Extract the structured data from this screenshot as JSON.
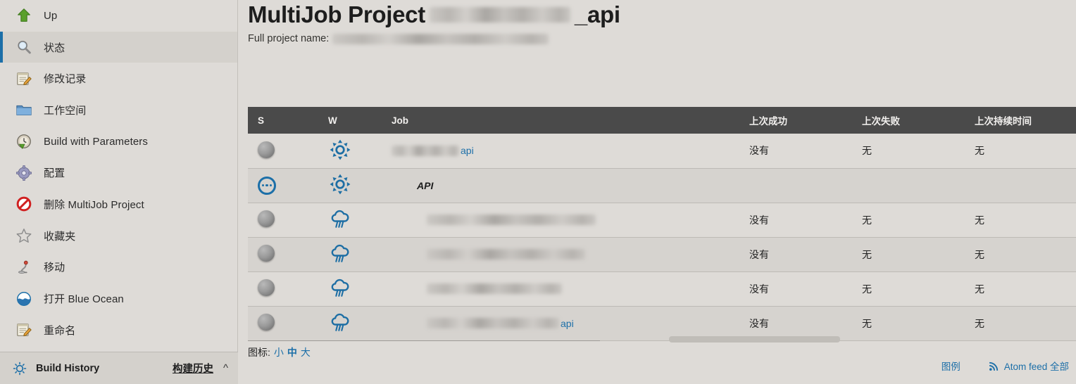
{
  "sidebar": {
    "items": [
      {
        "label": "Up",
        "icon": "up-arrow-icon",
        "active": false
      },
      {
        "label": "状态",
        "icon": "magnifier-icon",
        "active": true
      },
      {
        "label": "修改记录",
        "icon": "notepad-pencil-icon",
        "active": false
      },
      {
        "label": "工作空间",
        "icon": "folder-icon",
        "active": false
      },
      {
        "label": "Build with Parameters",
        "icon": "build-clock-icon",
        "active": false
      },
      {
        "label": "配置",
        "icon": "gear-icon",
        "active": false
      },
      {
        "label": "删除 MultiJob Project",
        "icon": "delete-forbidden-icon",
        "active": false
      },
      {
        "label": "收藏夹",
        "icon": "star-icon",
        "active": false
      },
      {
        "label": "移动",
        "icon": "move-icon",
        "active": false
      },
      {
        "label": "打开 Blue Ocean",
        "icon": "blue-ocean-icon",
        "active": false
      },
      {
        "label": "重命名",
        "icon": "rename-pencil-icon",
        "active": false
      }
    ],
    "build_history": {
      "title": "Build History",
      "zh_label": "构建历史",
      "chevron": "^",
      "icon": "build-status-icon"
    }
  },
  "header": {
    "title_prefix": "MultiJob Project",
    "title_redacted_width": 200,
    "title_suffix": "_api",
    "full_project_label": "Full project name:",
    "full_project_redacted_width": 307
  },
  "table": {
    "columns": [
      {
        "key": "s",
        "label": "S"
      },
      {
        "key": "w",
        "label": "W"
      },
      {
        "key": "job",
        "label": "Job"
      },
      {
        "key": "last_success",
        "label": "上次成功"
      },
      {
        "key": "last_failure",
        "label": "上次失败"
      },
      {
        "key": "last_duration",
        "label": "上次持续时间"
      }
    ],
    "rows": [
      {
        "status_icon": "grey-ball-icon",
        "weather_icon": "sunny-icon",
        "job_redacted_width": 96,
        "job_suffix": "api",
        "job_italic": "",
        "job_indent": 0,
        "last_success": "没有",
        "last_failure": "无",
        "last_duration": "无"
      },
      {
        "status_icon": "pending-dots-icon",
        "weather_icon": "sunny-icon",
        "job_redacted_width": 0,
        "job_suffix": "",
        "job_italic": "API",
        "job_indent": 36,
        "last_success": "",
        "last_failure": "",
        "last_duration": ""
      },
      {
        "status_icon": "grey-ball-icon",
        "weather_icon": "rain-cloud-icon",
        "job_redacted_width": 240,
        "job_suffix": "",
        "job_italic": "",
        "job_indent": 50,
        "last_success": "没有",
        "last_failure": "无",
        "last_duration": "无"
      },
      {
        "status_icon": "grey-ball-icon",
        "weather_icon": "rain-cloud-icon",
        "job_redacted_width": 225,
        "job_suffix": "",
        "job_italic": "",
        "job_indent": 50,
        "last_success": "没有",
        "last_failure": "无",
        "last_duration": "无"
      },
      {
        "status_icon": "grey-ball-icon",
        "weather_icon": "rain-cloud-icon",
        "job_redacted_width": 192,
        "job_suffix": "",
        "job_italic": "",
        "job_indent": 50,
        "last_success": "没有",
        "last_failure": "无",
        "last_duration": "无"
      },
      {
        "status_icon": "grey-ball-icon",
        "weather_icon": "rain-cloud-icon",
        "job_redacted_width": 188,
        "job_suffix": "api",
        "job_italic": "",
        "job_indent": 50,
        "last_success": "没有",
        "last_failure": "无",
        "last_duration": "无"
      }
    ]
  },
  "footer": {
    "icon_size_label": "图标:",
    "icon_sizes": [
      {
        "label": "小",
        "current": false
      },
      {
        "label": "中",
        "current": true
      },
      {
        "label": "大",
        "current": false
      }
    ],
    "legend_label": "图例",
    "atom_feed_label": "Atom feed 全部",
    "rss_icon": "rss-icon"
  },
  "colors": {
    "page_bg": "#dedbd7",
    "row_alt_bg": "#d6d3cf",
    "table_header_bg": "#4a4a4a",
    "accent_blue": "#1c6fa8",
    "sidebar_active_bg": "#d4d1cc"
  }
}
